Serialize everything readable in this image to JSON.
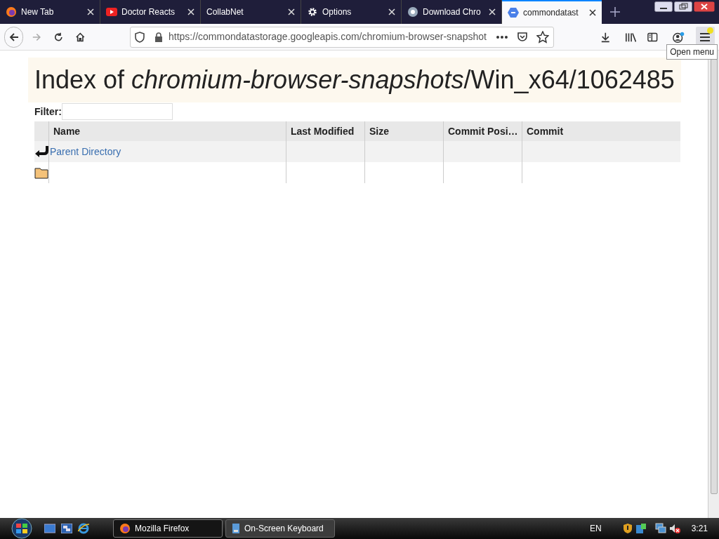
{
  "tabs": [
    {
      "kind": "firefox",
      "title": "New Tab",
      "selected": false
    },
    {
      "kind": "youtube",
      "title": "Doctor Reacts",
      "selected": false
    },
    {
      "kind": "none",
      "title": "CollabNet",
      "selected": false
    },
    {
      "kind": "gear",
      "title": "Options",
      "selected": false
    },
    {
      "kind": "chrome",
      "title": "Download Chro",
      "selected": false
    },
    {
      "kind": "cloud",
      "title": "commondatast",
      "selected": true
    }
  ],
  "address_bar": {
    "url": "https://commondatastorage.googleapis.com/chromium-browser-snapshot"
  },
  "tooltip": "Open menu",
  "page": {
    "heading": "Index of *chromium-browser-snapshots*/Win_x64/1062485",
    "filter_label": "Filter:",
    "table": {
      "columns": [
        "Name",
        "Last Modified",
        "Size",
        "Commit Posi…",
        "Commit"
      ],
      "rows": [
        {
          "kind": "parent",
          "name": "Parent Directory"
        },
        {
          "kind": "folder"
        }
      ]
    }
  },
  "taskbar": {
    "tasks": [
      {
        "kind": "firefox",
        "label": "Mozilla Firefox",
        "selected": true
      },
      {
        "kind": "keyboard",
        "label": "On-Screen Keyboard",
        "selected": false
      }
    ],
    "language": "EN",
    "clock": "3:21"
  }
}
